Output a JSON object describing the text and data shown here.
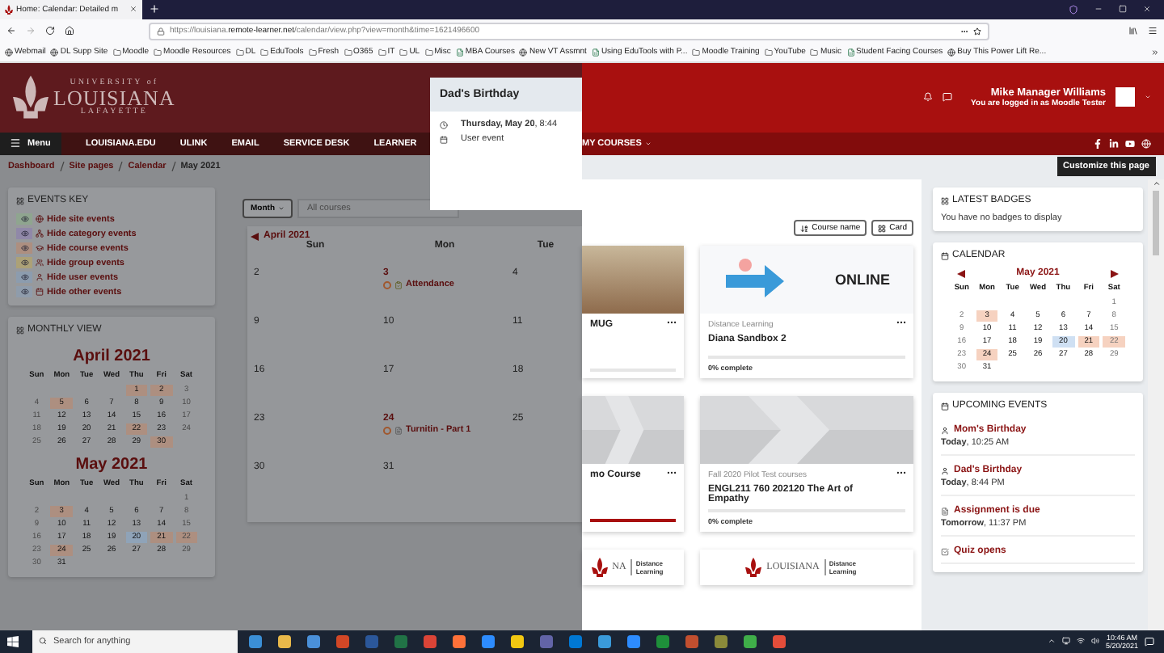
{
  "browser": {
    "tab_title": "Home: Calendar: Detailed m",
    "url_host": "https://louisiana.",
    "url_domain": "remote-learner.net",
    "url_path": "/calendar/view.php?view=month&time=1621496600",
    "bookmarks": [
      {
        "label": "Webmail",
        "kind": "page"
      },
      {
        "label": "DL Supp Site",
        "kind": "page"
      },
      {
        "label": "Moodle",
        "kind": "folder"
      },
      {
        "label": "Moodle Resources",
        "kind": "folder"
      },
      {
        "label": "DL",
        "kind": "folder"
      },
      {
        "label": "EduTools",
        "kind": "folder"
      },
      {
        "label": "Fresh",
        "kind": "folder"
      },
      {
        "label": "O365",
        "kind": "folder"
      },
      {
        "label": "IT",
        "kind": "folder"
      },
      {
        "label": "UL",
        "kind": "folder"
      },
      {
        "label": "Misc",
        "kind": "folder"
      },
      {
        "label": "MBA Courses",
        "kind": "sheet"
      },
      {
        "label": "New VT Assmnt",
        "kind": "page"
      },
      {
        "label": "Using EduTools with P...",
        "kind": "sheet"
      },
      {
        "label": "Moodle Training",
        "kind": "folder"
      },
      {
        "label": "YouTube",
        "kind": "folder"
      },
      {
        "label": "Music",
        "kind": "folder"
      },
      {
        "label": "Student Facing Courses",
        "kind": "sheet"
      },
      {
        "label": "Buy This Power Lift Re...",
        "kind": "page"
      }
    ]
  },
  "header": {
    "logo_top": "UNIVERSITY of",
    "logo_main": "LOUISIANA",
    "logo_bottom": "LAFAYETTE",
    "user_name": "Mike Manager Williams",
    "login_note": "You are logged in as Moodle Tester"
  },
  "nav": {
    "menu_label": "Menu",
    "items": [
      "LOUISIANA.EDU",
      "ULINK",
      "EMAIL",
      "SERVICE DESK",
      "LEARNER"
    ],
    "my_courses": "MY COURSES"
  },
  "breadcrumb": {
    "items": [
      "Dashboard",
      "Site pages",
      "Calendar",
      "May 2021"
    ],
    "customize_button": "Customize this page"
  },
  "popover": {
    "title": "Dad's Birthday",
    "when": "**Thursday, May 20**, 8:44",
    "type": "User event"
  },
  "events_key": {
    "title": "EVENTS KEY",
    "items": [
      {
        "label": "Hide site events",
        "kind": "site",
        "color": "#8fa58f"
      },
      {
        "label": "Hide category events",
        "kind": "category",
        "color": "#9088a8"
      },
      {
        "label": "Hide course events",
        "kind": "course",
        "color": "#ad8f80"
      },
      {
        "label": "Hide group events",
        "kind": "group",
        "color": "#aca177"
      },
      {
        "label": "Hide user events",
        "kind": "user",
        "color": "#8c9cae"
      },
      {
        "label": "Hide other events",
        "kind": "other",
        "color": "#8f9cab"
      }
    ]
  },
  "monthly_view": {
    "title": "MONTHLY VIEW",
    "months": [
      {
        "title": "April 2021",
        "weekdays": [
          "Sun",
          "Mon",
          "Tue",
          "Wed",
          "Thu",
          "Fri",
          "Sat"
        ],
        "weeks": [
          [
            {
              "kind": "blank"
            },
            {
              "kind": "blank"
            },
            {
              "kind": "blank"
            },
            {
              "kind": "blank"
            },
            {
              "kind": "day",
              "day": "1",
              "event": true,
              "today": false
            },
            {
              "kind": "day",
              "day": "2",
              "event": true,
              "today": false
            },
            {
              "kind": "day",
              "day": "3",
              "event": false,
              "today": false
            }
          ],
          [
            {
              "kind": "day",
              "day": "4",
              "event": false,
              "today": false
            },
            {
              "kind": "day",
              "day": "5",
              "event": true,
              "today": false
            },
            {
              "kind": "day",
              "day": "6",
              "event": false,
              "today": false
            },
            {
              "kind": "day",
              "day": "7",
              "event": false,
              "today": false
            },
            {
              "kind": "day",
              "day": "8",
              "event": false,
              "today": false
            },
            {
              "kind": "day",
              "day": "9",
              "event": false,
              "today": false
            },
            {
              "kind": "day",
              "day": "10",
              "event": false,
              "today": false
            }
          ],
          [
            {
              "kind": "day",
              "day": "11",
              "event": false,
              "today": false
            },
            {
              "kind": "day",
              "day": "12",
              "event": false,
              "today": false
            },
            {
              "kind": "day",
              "day": "13",
              "event": false,
              "today": false
            },
            {
              "kind": "day",
              "day": "14",
              "event": false,
              "today": false
            },
            {
              "kind": "day",
              "day": "15",
              "event": false,
              "today": false
            },
            {
              "kind": "day",
              "day": "16",
              "event": false,
              "today": false
            },
            {
              "kind": "day",
              "day": "17",
              "event": false,
              "today": false
            }
          ],
          [
            {
              "kind": "day",
              "day": "18",
              "event": false,
              "today": false
            },
            {
              "kind": "day",
              "day": "19",
              "event": false,
              "today": false
            },
            {
              "kind": "day",
              "day": "20",
              "event": false,
              "today": false
            },
            {
              "kind": "day",
              "day": "21",
              "event": false,
              "today": false
            },
            {
              "kind": "day",
              "day": "22",
              "event": true,
              "today": false
            },
            {
              "kind": "day",
              "day": "23",
              "event": false,
              "today": false
            },
            {
              "kind": "day",
              "day": "24",
              "event": false,
              "today": false
            }
          ],
          [
            {
              "kind": "day",
              "day": "25",
              "event": false,
              "today": false
            },
            {
              "kind": "day",
              "day": "26",
              "event": false,
              "today": false
            },
            {
              "kind": "day",
              "day": "27",
              "event": false,
              "today": false
            },
            {
              "kind": "day",
              "day": "28",
              "event": false,
              "today": false
            },
            {
              "kind": "day",
              "day": "29",
              "event": false,
              "today": false
            },
            {
              "kind": "day",
              "day": "30",
              "event": true,
              "today": false
            },
            {
              "kind": "blank"
            }
          ]
        ]
      },
      {
        "title": "May 2021",
        "weekdays": [
          "Sun",
          "Mon",
          "Tue",
          "Wed",
          "Thu",
          "Fri",
          "Sat"
        ],
        "weeks": [
          [
            {
              "kind": "blank"
            },
            {
              "kind": "blank"
            },
            {
              "kind": "blank"
            },
            {
              "kind": "blank"
            },
            {
              "kind": "blank"
            },
            {
              "kind": "blank"
            },
            {
              "kind": "day",
              "day": "1",
              "event": false,
              "today": false
            }
          ],
          [
            {
              "kind": "day",
              "day": "2",
              "event": false,
              "today": false
            },
            {
              "kind": "day",
              "day": "3",
              "event": true,
              "today": false
            },
            {
              "kind": "day",
              "day": "4",
              "event": false,
              "today": false
            },
            {
              "kind": "day",
              "day": "5",
              "event": false,
              "today": false
            },
            {
              "kind": "day",
              "day": "6",
              "event": false,
              "today": false
            },
            {
              "kind": "day",
              "day": "7",
              "event": false,
              "today": false
            },
            {
              "kind": "day",
              "day": "8",
              "event": false,
              "today": false
            }
          ],
          [
            {
              "kind": "day",
              "day": "9",
              "event": false,
              "today": false
            },
            {
              "kind": "day",
              "day": "10",
              "event": false,
              "today": false
            },
            {
              "kind": "day",
              "day": "11",
              "event": false,
              "today": false
            },
            {
              "kind": "day",
              "day": "12",
              "event": false,
              "today": false
            },
            {
              "kind": "day",
              "day": "13",
              "event": false,
              "today": false
            },
            {
              "kind": "day",
              "day": "14",
              "event": false,
              "today": false
            },
            {
              "kind": "day",
              "day": "15",
              "event": false,
              "today": false
            }
          ],
          [
            {
              "kind": "day",
              "day": "16",
              "event": false,
              "today": false
            },
            {
              "kind": "day",
              "day": "17",
              "event": false,
              "today": false
            },
            {
              "kind": "day",
              "day": "18",
              "event": false,
              "today": false
            },
            {
              "kind": "day",
              "day": "19",
              "event": false,
              "today": false
            },
            {
              "kind": "day",
              "day": "20",
              "event": false,
              "today": true
            },
            {
              "kind": "day",
              "day": "21",
              "event": true,
              "today": false
            },
            {
              "kind": "day",
              "day": "22",
              "event": true,
              "today": false
            }
          ],
          [
            {
              "kind": "day",
              "day": "23",
              "event": false,
              "today": false
            },
            {
              "kind": "day",
              "day": "24",
              "event": true,
              "today": false
            },
            {
              "kind": "day",
              "day": "25",
              "event": false,
              "today": false
            },
            {
              "kind": "day",
              "day": "26",
              "event": false,
              "today": false
            },
            {
              "kind": "day",
              "day": "27",
              "event": false,
              "today": false
            },
            {
              "kind": "day",
              "day": "28",
              "event": false,
              "today": false
            },
            {
              "kind": "day",
              "day": "29",
              "event": false,
              "today": false
            }
          ],
          [
            {
              "kind": "day",
              "day": "30",
              "event": false,
              "today": false
            },
            {
              "kind": "day",
              "day": "31",
              "event": false,
              "today": false
            },
            {
              "kind": "blank"
            },
            {
              "kind": "blank"
            },
            {
              "kind": "blank"
            },
            {
              "kind": "blank"
            },
            {
              "kind": "blank"
            }
          ]
        ]
      }
    ]
  },
  "calendar_view": {
    "view_button": "Month",
    "course_select": "All courses",
    "prev_month": "April 2021",
    "columns": [
      "Sun",
      "Mon",
      "Tue"
    ],
    "weeks": [
      [
        {
          "day": "2"
        },
        {
          "day": "3",
          "events": [
            {
              "title": "Attendance",
              "kind": "attendance"
            }
          ]
        },
        {
          "day": "4"
        }
      ],
      [
        {
          "day": "9"
        },
        {
          "day": "10"
        },
        {
          "day": "11"
        }
      ],
      [
        {
          "day": "16"
        },
        {
          "day": "17"
        },
        {
          "day": "18"
        }
      ],
      [
        {
          "day": "23"
        },
        {
          "day": "24",
          "events": [
            {
              "title": "Turnitin - Part 1",
              "kind": "assignment"
            }
          ]
        },
        {
          "day": "25"
        }
      ],
      [
        {
          "day": "30"
        },
        {
          "day": "31"
        }
      ]
    ]
  },
  "courses": {
    "sort_buttons": [
      {
        "label": "Course name",
        "kind": "sort"
      },
      {
        "label": "Card",
        "kind": "view"
      }
    ],
    "cards": [
      {
        "kind": "photo",
        "title": "MUG",
        "level": 0
      },
      {
        "kind": "online",
        "image_text": "ONLINE",
        "category": "Distance Learning",
        "title": "Diana Sandbox 2",
        "level": 0,
        "progress_text": "0% complete"
      },
      {
        "kind": "pattern",
        "title": "mo Course",
        "level": 1
      },
      {
        "kind": "pattern",
        "category": "Fall 2020 Pilot Test courses",
        "title": "ENGL211 760 202120 The Art of Empathy",
        "level": 0,
        "progress_text": "0% complete"
      },
      {
        "kind": "logo",
        "logo_text": "NA",
        "logo_note": "Distance Learning"
      },
      {
        "kind": "logo",
        "logo_text": "LOUISIANA",
        "logo_note": "Distance Learning"
      }
    ]
  },
  "badges": {
    "title": "LATEST BADGES",
    "message": "You have no badges to display"
  },
  "sidebar_calendar": {
    "title": "CALENDAR",
    "month": {
      "title": "May 2021",
      "weekdays": [
        "Sun",
        "Mon",
        "Tue",
        "Wed",
        "Thu",
        "Fri",
        "Sat"
      ],
      "weeks": [
        [
          {
            "kind": "blank"
          },
          {
            "kind": "blank"
          },
          {
            "kind": "blank"
          },
          {
            "kind": "blank"
          },
          {
            "kind": "blank"
          },
          {
            "kind": "blank"
          },
          {
            "kind": "day",
            "day": "1",
            "event": false,
            "today": false
          }
        ],
        [
          {
            "kind": "day",
            "day": "2",
            "event": false,
            "today": false
          },
          {
            "kind": "day",
            "day": "3",
            "event": true,
            "today": false
          },
          {
            "kind": "day",
            "day": "4",
            "event": false,
            "today": false
          },
          {
            "kind": "day",
            "day": "5",
            "event": false,
            "today": false
          },
          {
            "kind": "day",
            "day": "6",
            "event": false,
            "today": false
          },
          {
            "kind": "day",
            "day": "7",
            "event": false,
            "today": false
          },
          {
            "kind": "day",
            "day": "8",
            "event": false,
            "today": false
          }
        ],
        [
          {
            "kind": "day",
            "day": "9",
            "event": false,
            "today": false
          },
          {
            "kind": "day",
            "day": "10",
            "event": false,
            "today": false
          },
          {
            "kind": "day",
            "day": "11",
            "event": false,
            "today": false
          },
          {
            "kind": "day",
            "day": "12",
            "event": false,
            "today": false
          },
          {
            "kind": "day",
            "day": "13",
            "event": false,
            "today": false
          },
          {
            "kind": "day",
            "day": "14",
            "event": false,
            "today": false
          },
          {
            "kind": "day",
            "day": "15",
            "event": false,
            "today": false
          }
        ],
        [
          {
            "kind": "day",
            "day": "16",
            "event": false,
            "today": false
          },
          {
            "kind": "day",
            "day": "17",
            "event": false,
            "today": false
          },
          {
            "kind": "day",
            "day": "18",
            "event": false,
            "today": false
          },
          {
            "kind": "day",
            "day": "19",
            "event": false,
            "today": false
          },
          {
            "kind": "day",
            "day": "20",
            "event": false,
            "today": true
          },
          {
            "kind": "day",
            "day": "21",
            "event": true,
            "today": false
          },
          {
            "kind": "day",
            "day": "22",
            "event": true,
            "today": false
          }
        ],
        [
          {
            "kind": "day",
            "day": "23",
            "event": false,
            "today": false
          },
          {
            "kind": "day",
            "day": "24",
            "event": true,
            "today": false
          },
          {
            "kind": "day",
            "day": "25",
            "event": false,
            "today": false
          },
          {
            "kind": "day",
            "day": "26",
            "event": false,
            "today": false
          },
          {
            "kind": "day",
            "day": "27",
            "event": false,
            "today": false
          },
          {
            "kind": "day",
            "day": "28",
            "event": false,
            "today": false
          },
          {
            "kind": "day",
            "day": "29",
            "event": false,
            "today": false
          }
        ],
        [
          {
            "kind": "day",
            "day": "30",
            "event": false,
            "today": false
          },
          {
            "kind": "day",
            "day": "31",
            "event": false,
            "today": false
          },
          {
            "kind": "blank"
          },
          {
            "kind": "blank"
          },
          {
            "kind": "blank"
          },
          {
            "kind": "blank"
          },
          {
            "kind": "blank"
          }
        ]
      ]
    }
  },
  "upcoming": {
    "title": "UPCOMING EVENTS",
    "events": [
      {
        "title": "Mom's Birthday",
        "kind": "user",
        "when": "**Today**, 10:25 AM"
      },
      {
        "title": "Dad's Birthday",
        "kind": "user",
        "when": "**Today**, 8:44 PM"
      },
      {
        "title": "Assignment is due",
        "kind": "assignment",
        "when": "**Tomorrow**, 11:37 PM"
      },
      {
        "title": "Quiz opens",
        "kind": "quiz"
      }
    ]
  },
  "taskbar": {
    "search_placeholder": "Search for anything",
    "time": "10:46 AM",
    "date": "5/20/2021"
  }
}
